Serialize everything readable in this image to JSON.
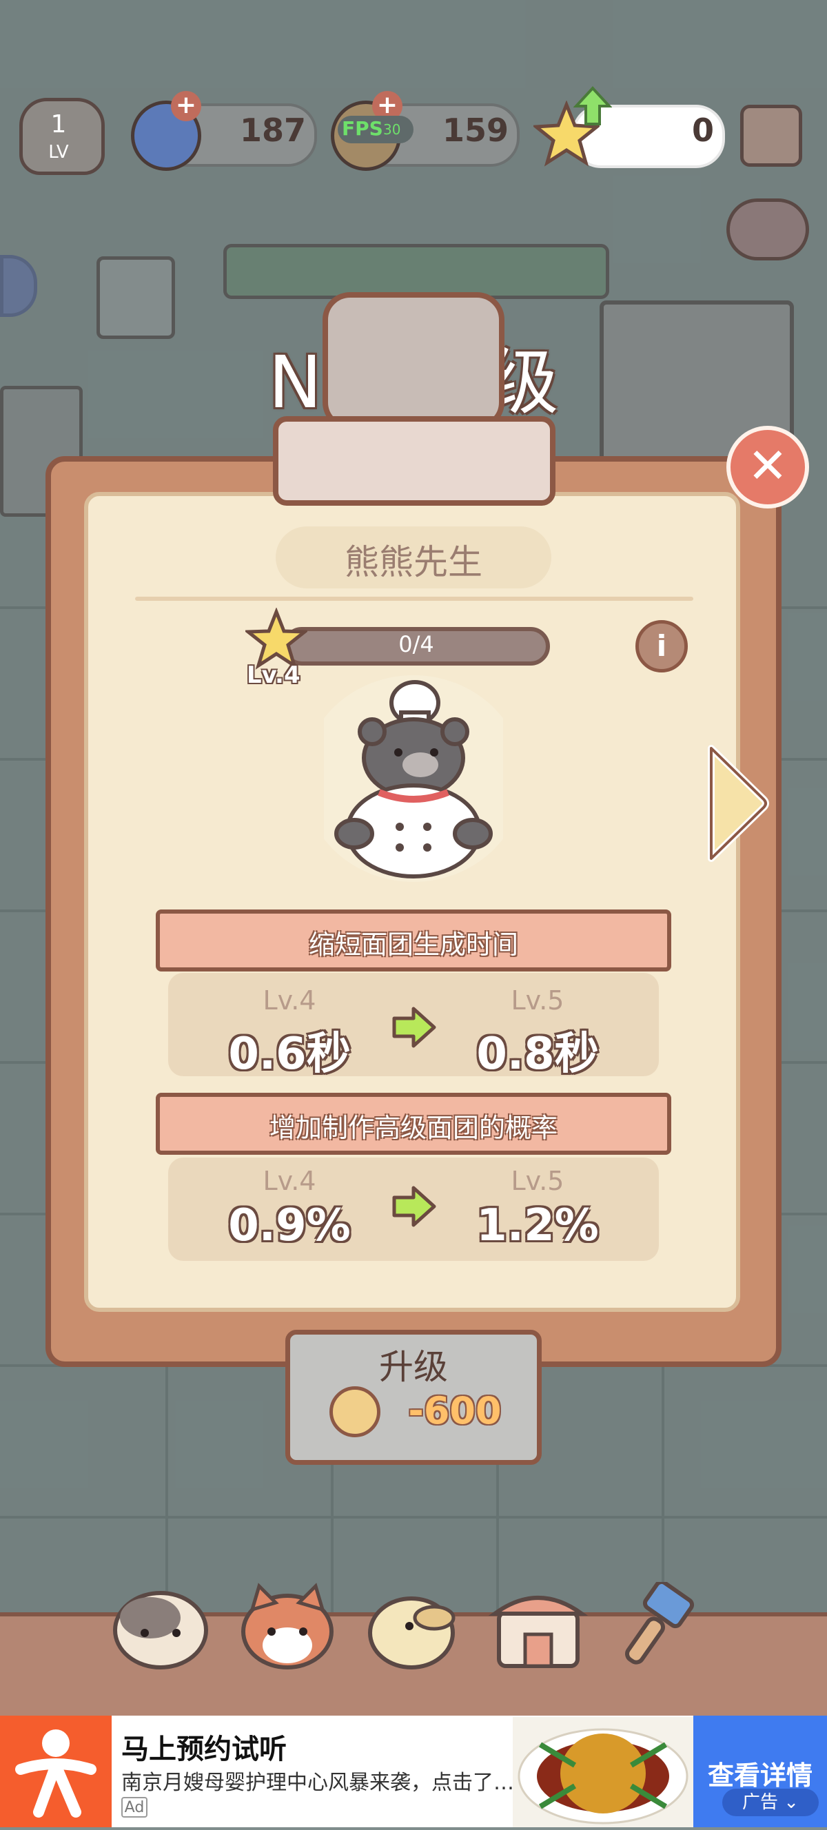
{
  "hud": {
    "level": "1",
    "level_tag": "LV",
    "gems": "187",
    "fps_label": "FPS",
    "fps_value": "30",
    "coins": "159",
    "stars": "0"
  },
  "dialog": {
    "title": "NPC升级",
    "npc_name": "熊熊先生",
    "progress": "0/4",
    "progress_fraction": 0.0,
    "level_badge": "Lv.4",
    "info_glyph": "i",
    "close_glyph": "✕"
  },
  "stats": [
    {
      "title": "缩短面团生成时间",
      "from_level": "Lv.4",
      "from_value": "0.6秒",
      "to_level": "Lv.5",
      "to_value": "0.8秒"
    },
    {
      "title": "增加制作高级面团的概率",
      "from_level": "Lv.4",
      "from_value": "0.9%",
      "to_level": "Lv.5",
      "to_value": "1.2%"
    }
  ],
  "upgrade": {
    "label": "升级",
    "cost": "-600"
  },
  "tabs": [
    {
      "icon": "hamster-icon"
    },
    {
      "icon": "red-panda-icon"
    },
    {
      "icon": "duck-icon"
    },
    {
      "icon": "shop-icon"
    },
    {
      "icon": "paint-brush-icon"
    }
  ],
  "ad": {
    "title": "马上预约试听",
    "description": "南京月嫂母婴护理中心风暴来袭，点击了解详情",
    "tag": "Ad",
    "cta": "查看详情",
    "badge": "广告"
  },
  "colors": {
    "board": "#c98e6e",
    "border": "#8c5845",
    "paper": "#f6ead0",
    "ribbon": "#f2b8a2",
    "close": "#e57a68",
    "ad_cta": "#3f7bf0"
  }
}
